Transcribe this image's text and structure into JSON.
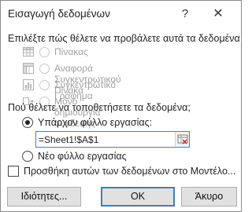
{
  "dialog": {
    "title": "Εισαγωγή δεδομένων",
    "help": "?",
    "close": "✕"
  },
  "display_section": {
    "label": "Επιλέξτε πώς θέλετε να προβάλετε αυτά τα δεδομένα",
    "options": [
      {
        "label": "Πίνακας",
        "icon": "table-icon",
        "selected": false,
        "enabled": false
      },
      {
        "label": "Αναφορά Συγκεντρωτικού Πίνακα",
        "icon": "pivot-table-icon",
        "selected": false,
        "enabled": false
      },
      {
        "label": "Συγκεντρωτικό Γράφημα",
        "icon": "pivot-chart-icon",
        "selected": false,
        "enabled": false
      },
      {
        "label": "Μόνο δημιουργία σύνδεσης",
        "icon": "connection-icon",
        "selected": false,
        "enabled": false
      }
    ]
  },
  "location_section": {
    "label": "Πού θέλετε να τοποθετήσετε τα δεδομένα;",
    "existing_label": "Υπάρχον φύλλο εργασίας:",
    "existing_selected": true,
    "reference_value": "=Sheet1!$A$1",
    "new_label": "Νέο φύλλο εργασίας",
    "new_selected": false
  },
  "data_model": {
    "label": "Προσθήκη αυτών των δεδομένων στο Μοντέλο...",
    "checked": false
  },
  "buttons": {
    "properties": "Ιδιότητες...",
    "ok": "OK",
    "cancel": "Άκυρο"
  },
  "colors": {
    "accent": "#3c7fb1",
    "disabled_text": "#a0a0a0",
    "button_face": "#e1e1e1"
  }
}
